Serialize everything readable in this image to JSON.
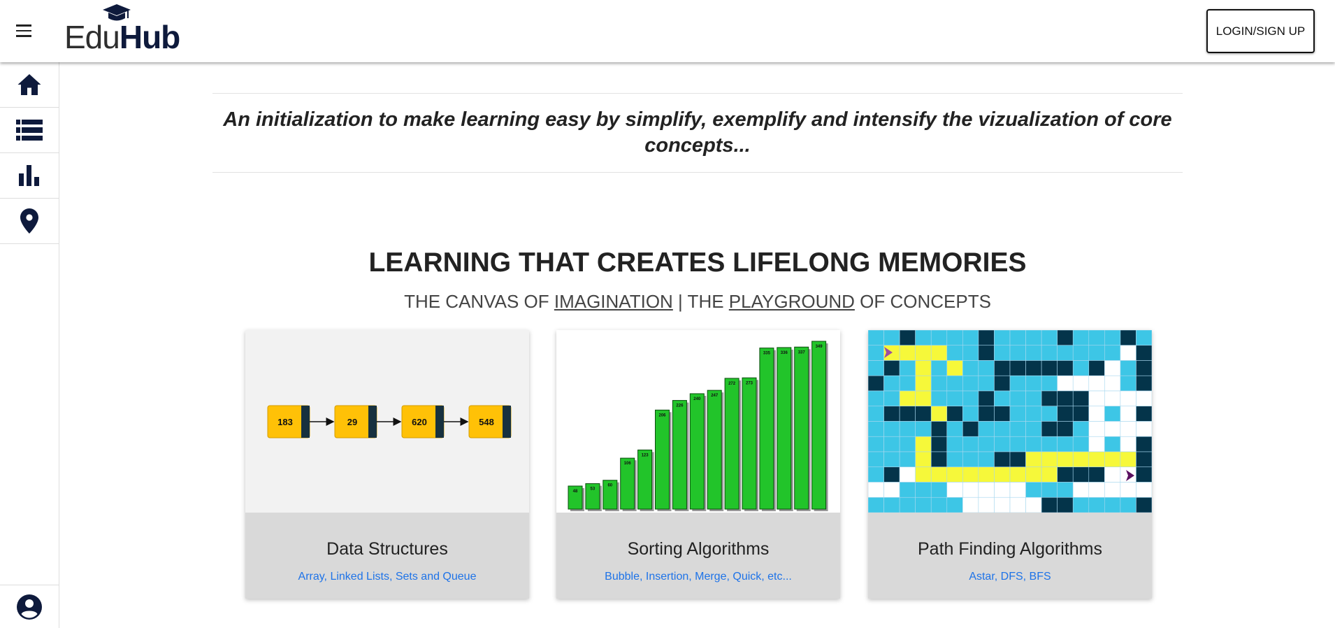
{
  "header": {
    "logo_prefix": "Edu",
    "logo_suffix": "Hub",
    "login_label": "LOGIN/SIGN UP"
  },
  "sidebar": {
    "items": [
      {
        "icon": "home-icon"
      },
      {
        "icon": "list-icon"
      },
      {
        "icon": "bar-chart-icon"
      },
      {
        "icon": "location-pin-icon"
      }
    ],
    "bottom_icon": "account-circle-icon"
  },
  "main": {
    "tagline": "An initialization to make learning easy by simplify, exemplify and intensify the vizualization of core concepts...",
    "headline": "LEARNING THAT CREATES LIFELONG MEMORIES",
    "subline": {
      "part1": "THE CANVAS OF ",
      "link1": "IMAGINATION",
      "part2": " | THE ",
      "link2": "PLAYGROUND",
      "part3": " OF CONCEPTS"
    },
    "cards": [
      {
        "title": "Data Structures",
        "desc": "Array, Linked Lists, Sets and Queue",
        "nodes": [
          "183",
          "29",
          "620",
          "548"
        ]
      },
      {
        "title": "Sorting Algorithms",
        "desc": "Bubble, Insertion, Merge, Quick, etc...",
        "bars": [
          "48",
          "53",
          "60",
          "106",
          "123",
          "206",
          "226",
          "240",
          "247",
          "272",
          "273",
          "335",
          "336",
          "337",
          "349"
        ]
      },
      {
        "title": "Path Finding Algorithms",
        "desc": "Astar, DFS, BFS"
      }
    ]
  },
  "colors": {
    "accent_navy": "#0e1a3c",
    "link_blue": "#1e73e8",
    "node_yellow": "#ffc107",
    "bar_green": "#22c42a",
    "grid_cyan": "#3dc6e6",
    "grid_dark": "#04344a",
    "path_yellow": "#f6f83a"
  }
}
